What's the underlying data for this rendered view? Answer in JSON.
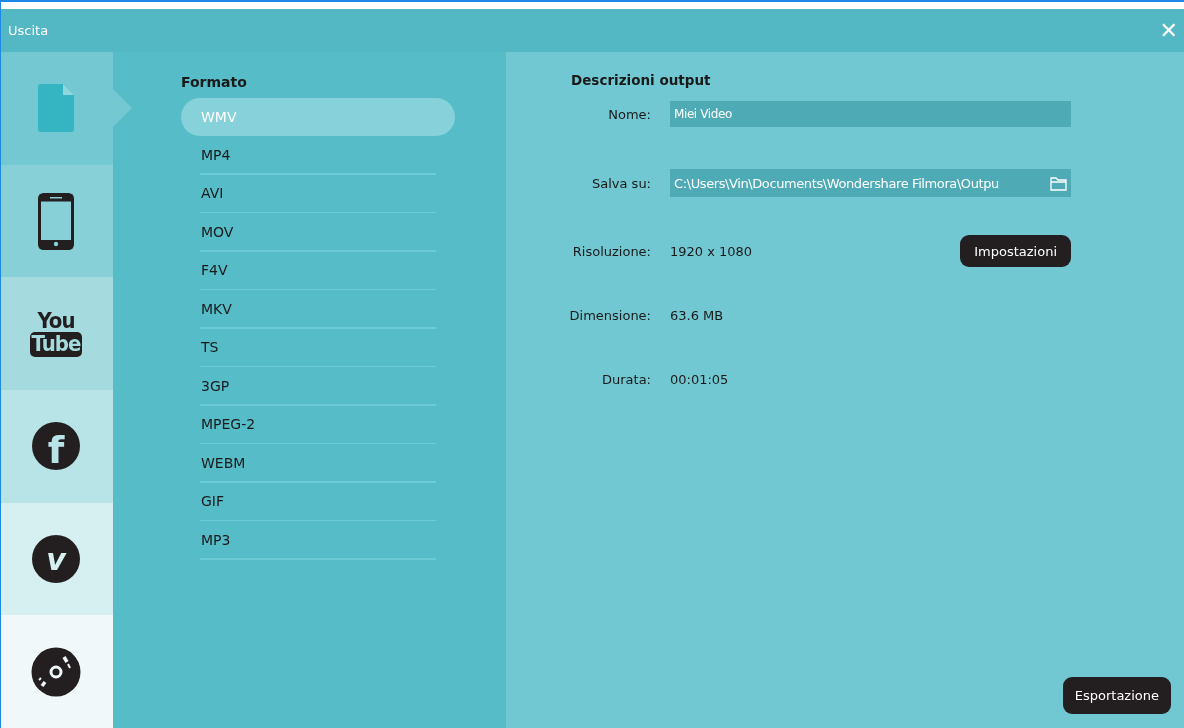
{
  "window": {
    "title": "Uscita",
    "close": "✕"
  },
  "sidebar": {
    "tabs": [
      {
        "kind": "file",
        "selected": true
      },
      {
        "kind": "phone",
        "selected": false
      },
      {
        "kind": "youtube",
        "selected": false,
        "glyph_lines": [
          "You",
          "Tube"
        ]
      },
      {
        "kind": "facebook",
        "selected": false,
        "glyph_lines": [
          "f"
        ]
      },
      {
        "kind": "vimeo",
        "selected": false,
        "glyph_lines": [
          "v"
        ]
      },
      {
        "kind": "disc",
        "selected": false
      }
    ]
  },
  "format_panel": {
    "heading": "Formato",
    "formats": [
      {
        "label": "WMV",
        "selected": true
      },
      {
        "label": "MP4",
        "selected": false
      },
      {
        "label": "AVI",
        "selected": false
      },
      {
        "label": "MOV",
        "selected": false
      },
      {
        "label": "F4V",
        "selected": false
      },
      {
        "label": "MKV",
        "selected": false
      },
      {
        "label": "TS",
        "selected": false
      },
      {
        "label": "3GP",
        "selected": false
      },
      {
        "label": "MPEG-2",
        "selected": false
      },
      {
        "label": "WEBM",
        "selected": false
      },
      {
        "label": "GIF",
        "selected": false
      },
      {
        "label": "MP3",
        "selected": false
      }
    ]
  },
  "output_panel": {
    "heading": "Descrizioni output",
    "fields": [
      {
        "kind": "input",
        "label": "Nome:",
        "value": "Miei Video"
      },
      {
        "kind": "path",
        "label": "Salva su:",
        "value": "C:\\Users\\Vin\\Documents\\Wondershare Filmora\\Outpu"
      },
      {
        "kind": "info",
        "label": "Risoluzione:",
        "value": "1920 x 1080",
        "button": "Impostazioni"
      },
      {
        "kind": "info",
        "label": "Dimensione:",
        "value": "63.6 MB"
      },
      {
        "kind": "info",
        "label": "Durata:",
        "value": "00:01:05"
      }
    ]
  },
  "export_button": "Esportazione"
}
